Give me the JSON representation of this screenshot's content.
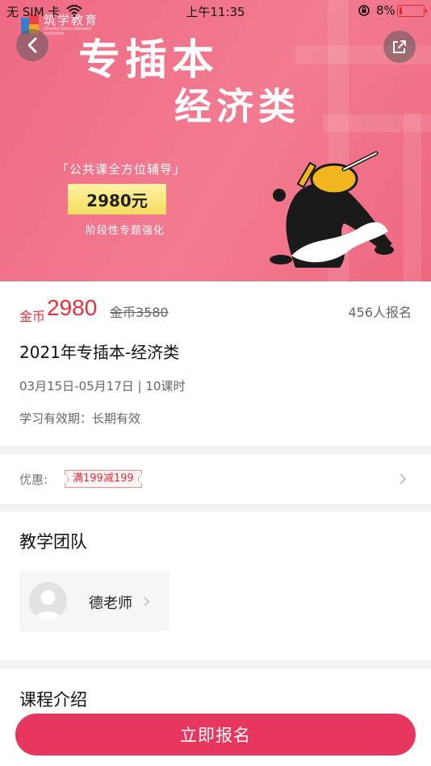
{
  "status_bar": {
    "carrier": "无 SIM 卡",
    "time": "上午11:35",
    "battery": "8%"
  },
  "banner": {
    "logo_text": "筑学教育",
    "logo_sub": "Oriental Jiaoyu Network Institution",
    "title_line1": "专插本",
    "title_line2": "经济类",
    "tagline": "「公共课全方位辅导」",
    "price_tag": "2980元",
    "subline": "阶段性专题强化"
  },
  "course": {
    "price_label": "金币",
    "price": "2980",
    "original_price": "金币3580",
    "enrolled": "456人报名",
    "title": "2021年专插本-经济类",
    "dates": "03月15日-05月17日 | 10课时",
    "validity": "学习有效期：长期有效"
  },
  "promo": {
    "label": "优惠:",
    "coupon": "满199减199"
  },
  "team": {
    "title": "教学团队",
    "teacher_name": "德老师"
  },
  "intro": {
    "title": "课程介绍"
  },
  "cta": {
    "label": "立即报名"
  },
  "colors": {
    "banner_pink": "#f06f87",
    "accent_red": "#e8303a",
    "cta_pink": "#e8375f"
  }
}
